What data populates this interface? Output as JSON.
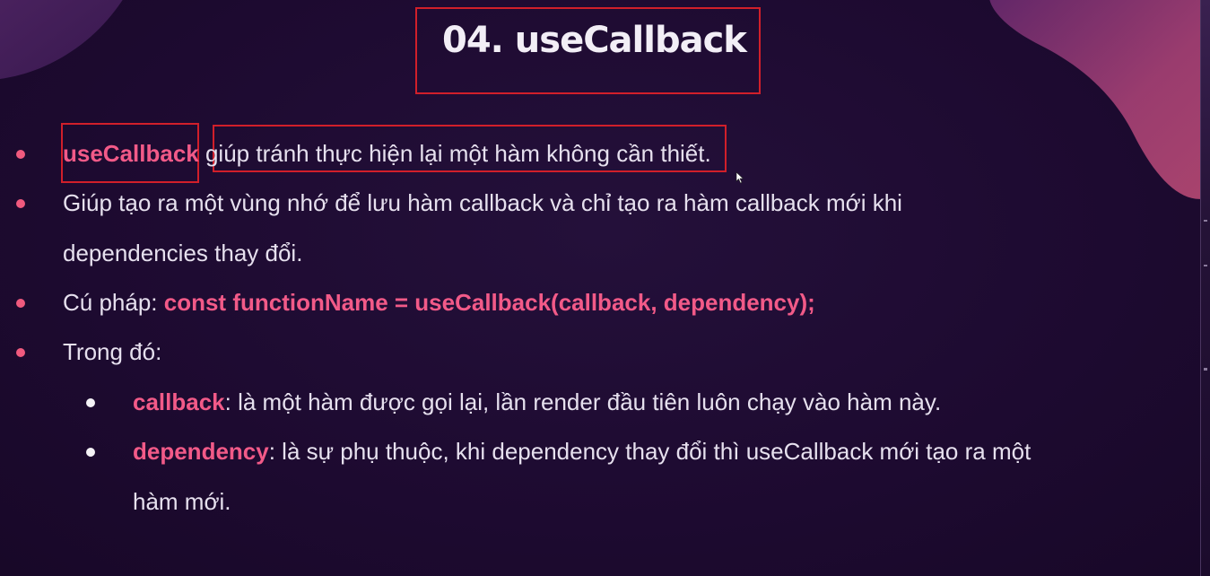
{
  "slide": {
    "title": "04. useCallback",
    "bullets": [
      {
        "keyword": "useCallback",
        "text": " giúp tránh thực hiện lại một hàm không cần thiết."
      },
      {
        "line1": "Giúp tạo ra một vùng nhớ để lưu hàm callback và chỉ tạo ra hàm callback mới khi",
        "line2": "dependencies thay đổi."
      },
      {
        "label": "Cú pháp: ",
        "code": "const functionName = useCallback(callback, dependency);"
      },
      {
        "text": "Trong đó:"
      }
    ],
    "sub_bullets": [
      {
        "keyword": "callback",
        "text": ": là một hàm được gọi lại, lần render đầu tiên luôn chạy vào hàm này."
      },
      {
        "keyword": "dependency",
        "line1": ": là sự phụ thuộc, khi dependency thay đổi thì useCallback mới tạo ra một",
        "line2": "hàm mới."
      }
    ]
  },
  "colors": {
    "background": "#1f0b33",
    "accent_pink": "#f25a88",
    "bullet_pink": "#f05a7e",
    "highlight_red": "#d11f2a",
    "text": "#e6e0ee"
  }
}
